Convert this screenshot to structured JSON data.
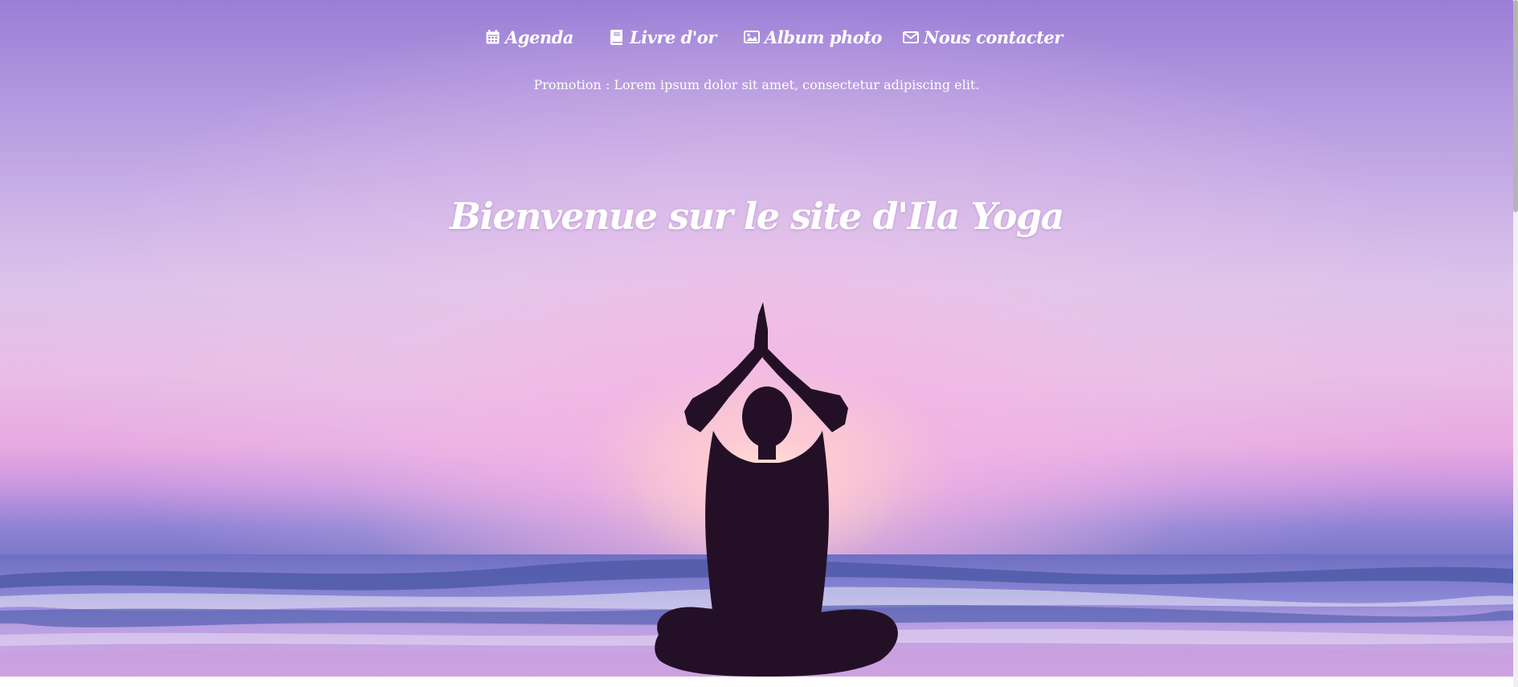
{
  "nav": {
    "items": [
      {
        "label": "Agenda",
        "icon": "calendar-icon"
      },
      {
        "label": "Livre d'or",
        "icon": "book-icon"
      },
      {
        "label": "Album photo",
        "icon": "image-icon"
      },
      {
        "label": "Nous contacter",
        "icon": "envelope-icon"
      }
    ]
  },
  "promo": {
    "text": "Promotion : Lorem ipsum dolor sit amet, consectetur adipiscing elit."
  },
  "hero": {
    "title": "Bienvenue sur le site d'Ila Yoga"
  },
  "colors": {
    "sky_top": "#9a7ed6",
    "sky_glow": "#e8bde6",
    "sea": "#6c6fbe",
    "silhouette": "#241026",
    "text": "#ffffff"
  }
}
